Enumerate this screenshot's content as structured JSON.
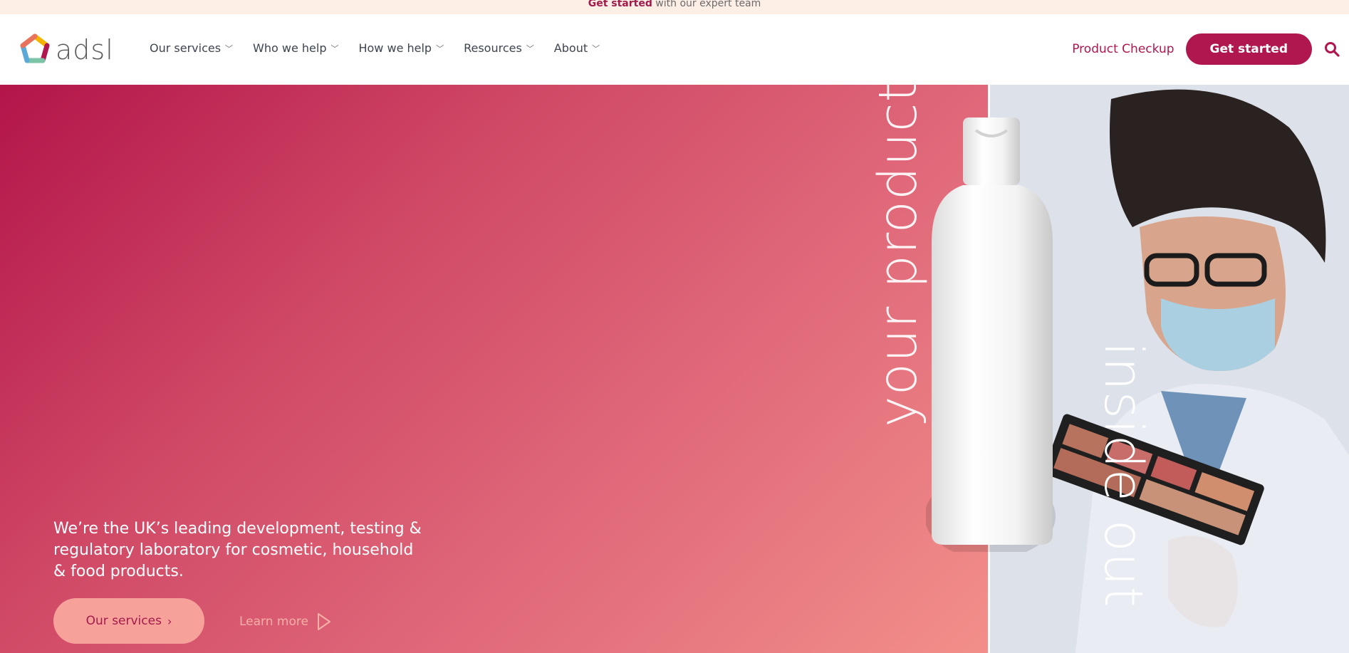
{
  "announcement": {
    "bold": "Get started",
    "rest": " with our expert team"
  },
  "brand": {
    "name": "adsl",
    "primary_color": "#b0174f",
    "logo_icon": "pentagon-logo-icon"
  },
  "nav": {
    "items": [
      {
        "label": "Our services"
      },
      {
        "label": "Who we help"
      },
      {
        "label": "How we help"
      },
      {
        "label": "Resources"
      },
      {
        "label": "About"
      }
    ]
  },
  "header_actions": {
    "product_checkup": "Product Checkup",
    "get_started": "Get started",
    "search_icon": "search-icon"
  },
  "hero": {
    "vertical_text_1": "your product",
    "vertical_text_2": "inside out",
    "tagline": "We’re the UK’s leading development, testing & regulatory laboratory for cosmetic, household & food products.",
    "primary_button": "Our services",
    "secondary_button": "Learn more",
    "gradient_colors": [
      "#b3154a",
      "#f28f8a"
    ]
  }
}
